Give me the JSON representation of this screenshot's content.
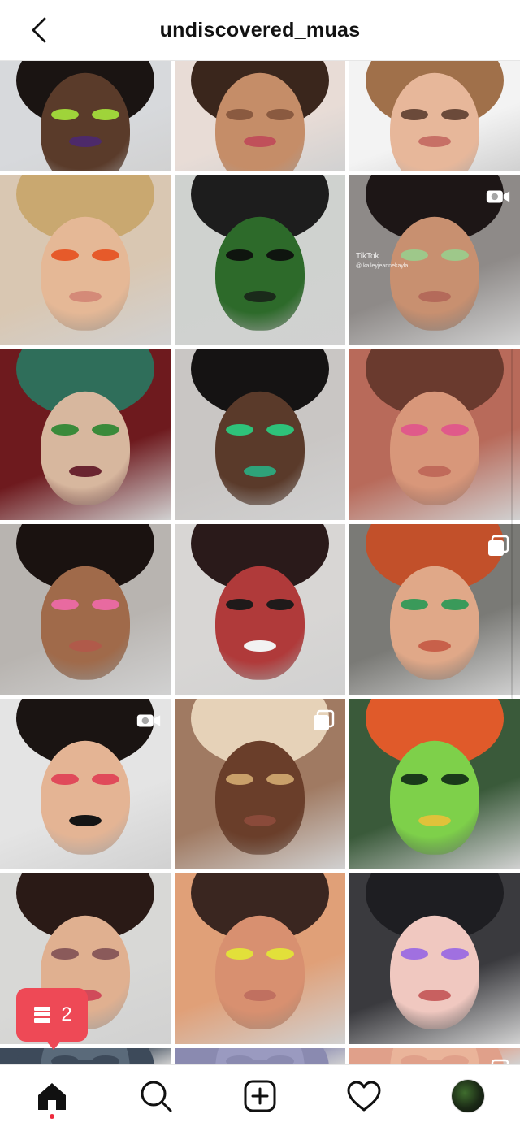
{
  "header": {
    "title": "undiscovered_muas",
    "back_icon": "chevron-left-icon"
  },
  "grid": {
    "tiles": [
      {
        "bg": "#d7d9dc",
        "skin": "#5a3b2a",
        "hair": "#1a1412",
        "eye": "#9fd43a",
        "lips": "#4d2a6a",
        "badge": ""
      },
      {
        "bg": "#e8dcd6",
        "skin": "#c58d68",
        "hair": "#3a261c",
        "eye": "#8a5a40",
        "lips": "#c0505a",
        "badge": ""
      },
      {
        "bg": "#f3f3f3",
        "skin": "#e7b79a",
        "hair": "#a0704a",
        "eye": "#6b4a3a",
        "lips": "#c77066",
        "badge": ""
      },
      {
        "bg": "#d9c7b2",
        "skin": "#e5b896",
        "hair": "#c9a870",
        "eye": "#e65a2a",
        "lips": "#d48a78",
        "badge": ""
      },
      {
        "bg": "#cfd2cf",
        "skin": "#2d6a2a",
        "hair": "#1d1d1d",
        "eye": "#0f150f",
        "lips": "#1a2a1a",
        "badge": ""
      },
      {
        "bg": "#8e8a88",
        "skin": "#c89070",
        "hair": "#1d1616",
        "eye": "#9ec88a",
        "lips": "#b46a5a",
        "badge": "video-camera-icon"
      },
      {
        "bg": "#6e1a1e",
        "skin": "#d7b79e",
        "hair": "#2f6e5a",
        "eye": "#3a8a3a",
        "lips": "#6a2530",
        "badge": ""
      },
      {
        "bg": "#c9c6c4",
        "skin": "#5a3a2a",
        "hair": "#151313",
        "eye": "#2ec27a",
        "lips": "#2ea37a",
        "badge": ""
      },
      {
        "bg": "#b86a5a",
        "skin": "#d8977a",
        "hair": "#6a3a2e",
        "eye": "#e05a8a",
        "lips": "#c06a5a",
        "badge": ""
      },
      {
        "bg": "#b8b4b0",
        "skin": "#a06a4a",
        "hair": "#1a1210",
        "eye": "#e86aa0",
        "lips": "#b05a4a",
        "badge": ""
      },
      {
        "bg": "#d8d6d4",
        "skin": "#b03a3a",
        "hair": "#2a1a1a",
        "eye": "#1f1a1a",
        "lips": "#f2f2f2",
        "badge": ""
      },
      {
        "bg": "#7a7a76",
        "skin": "#e0a888",
        "hair": "#c2502a",
        "eye": "#3a9a5a",
        "lips": "#c8604a",
        "badge": "multiple-posts-icon"
      },
      {
        "bg": "#e4e4e4",
        "skin": "#e4b494",
        "hair": "#1a1412",
        "eye": "#e04a5a",
        "lips": "#151515",
        "badge": "video-camera-icon"
      },
      {
        "bg": "#a07a62",
        "skin": "#6a3e2a",
        "hair": "#e6d2b8",
        "eye": "#c9a06a",
        "lips": "#8a4a3a",
        "badge": "multiple-posts-icon"
      },
      {
        "bg": "#3a5a3a",
        "skin": "#7ed04a",
        "hair": "#e05a2a",
        "eye": "#1a3a1a",
        "lips": "#e0c23a",
        "badge": ""
      },
      {
        "bg": "#d8d8d6",
        "skin": "#e0b090",
        "hair": "#2a1a16",
        "eye": "#8a5a5a",
        "lips": "#d04a5a",
        "badge": ""
      },
      {
        "bg": "#e0a078",
        "skin": "#d89070",
        "hair": "#3a2620",
        "eye": "#e2e03a",
        "lips": "#c07060",
        "badge": ""
      },
      {
        "bg": "#3a3a3e",
        "skin": "#f0c8c0",
        "hair": "#1e1e22",
        "eye": "#a070e0",
        "lips": "#c86060",
        "badge": ""
      },
      {
        "bg": "#3d4a5a",
        "skin": "#5a6a7a",
        "hair": "#3d4a5a",
        "eye": "#3d4a5a",
        "lips": "#3d4a5a",
        "badge": ""
      },
      {
        "bg": "#8a8ab0",
        "skin": "#9a9ac0",
        "hair": "#8a8ab0",
        "eye": "#8a8ab0",
        "lips": "#8a8ab0",
        "badge": ""
      },
      {
        "bg": "#e0a08a",
        "skin": "#eab49a",
        "hair": "#e0a08a",
        "eye": "#e0a08a",
        "lips": "#e0a08a",
        "badge": "multiple-posts-icon"
      }
    ],
    "tiktok_label": "TikTok",
    "tiktok_handle": "@ kaileyjeannekayla"
  },
  "notification": {
    "count": "2",
    "icon": "posts-icon",
    "color": "#ee4956"
  },
  "bottom_nav": {
    "items": [
      {
        "name": "home-icon",
        "active": true
      },
      {
        "name": "search-icon",
        "active": false
      },
      {
        "name": "new-post-icon",
        "active": false
      },
      {
        "name": "activity-heart-icon",
        "active": false
      },
      {
        "name": "profile-avatar",
        "active": false
      }
    ]
  }
}
